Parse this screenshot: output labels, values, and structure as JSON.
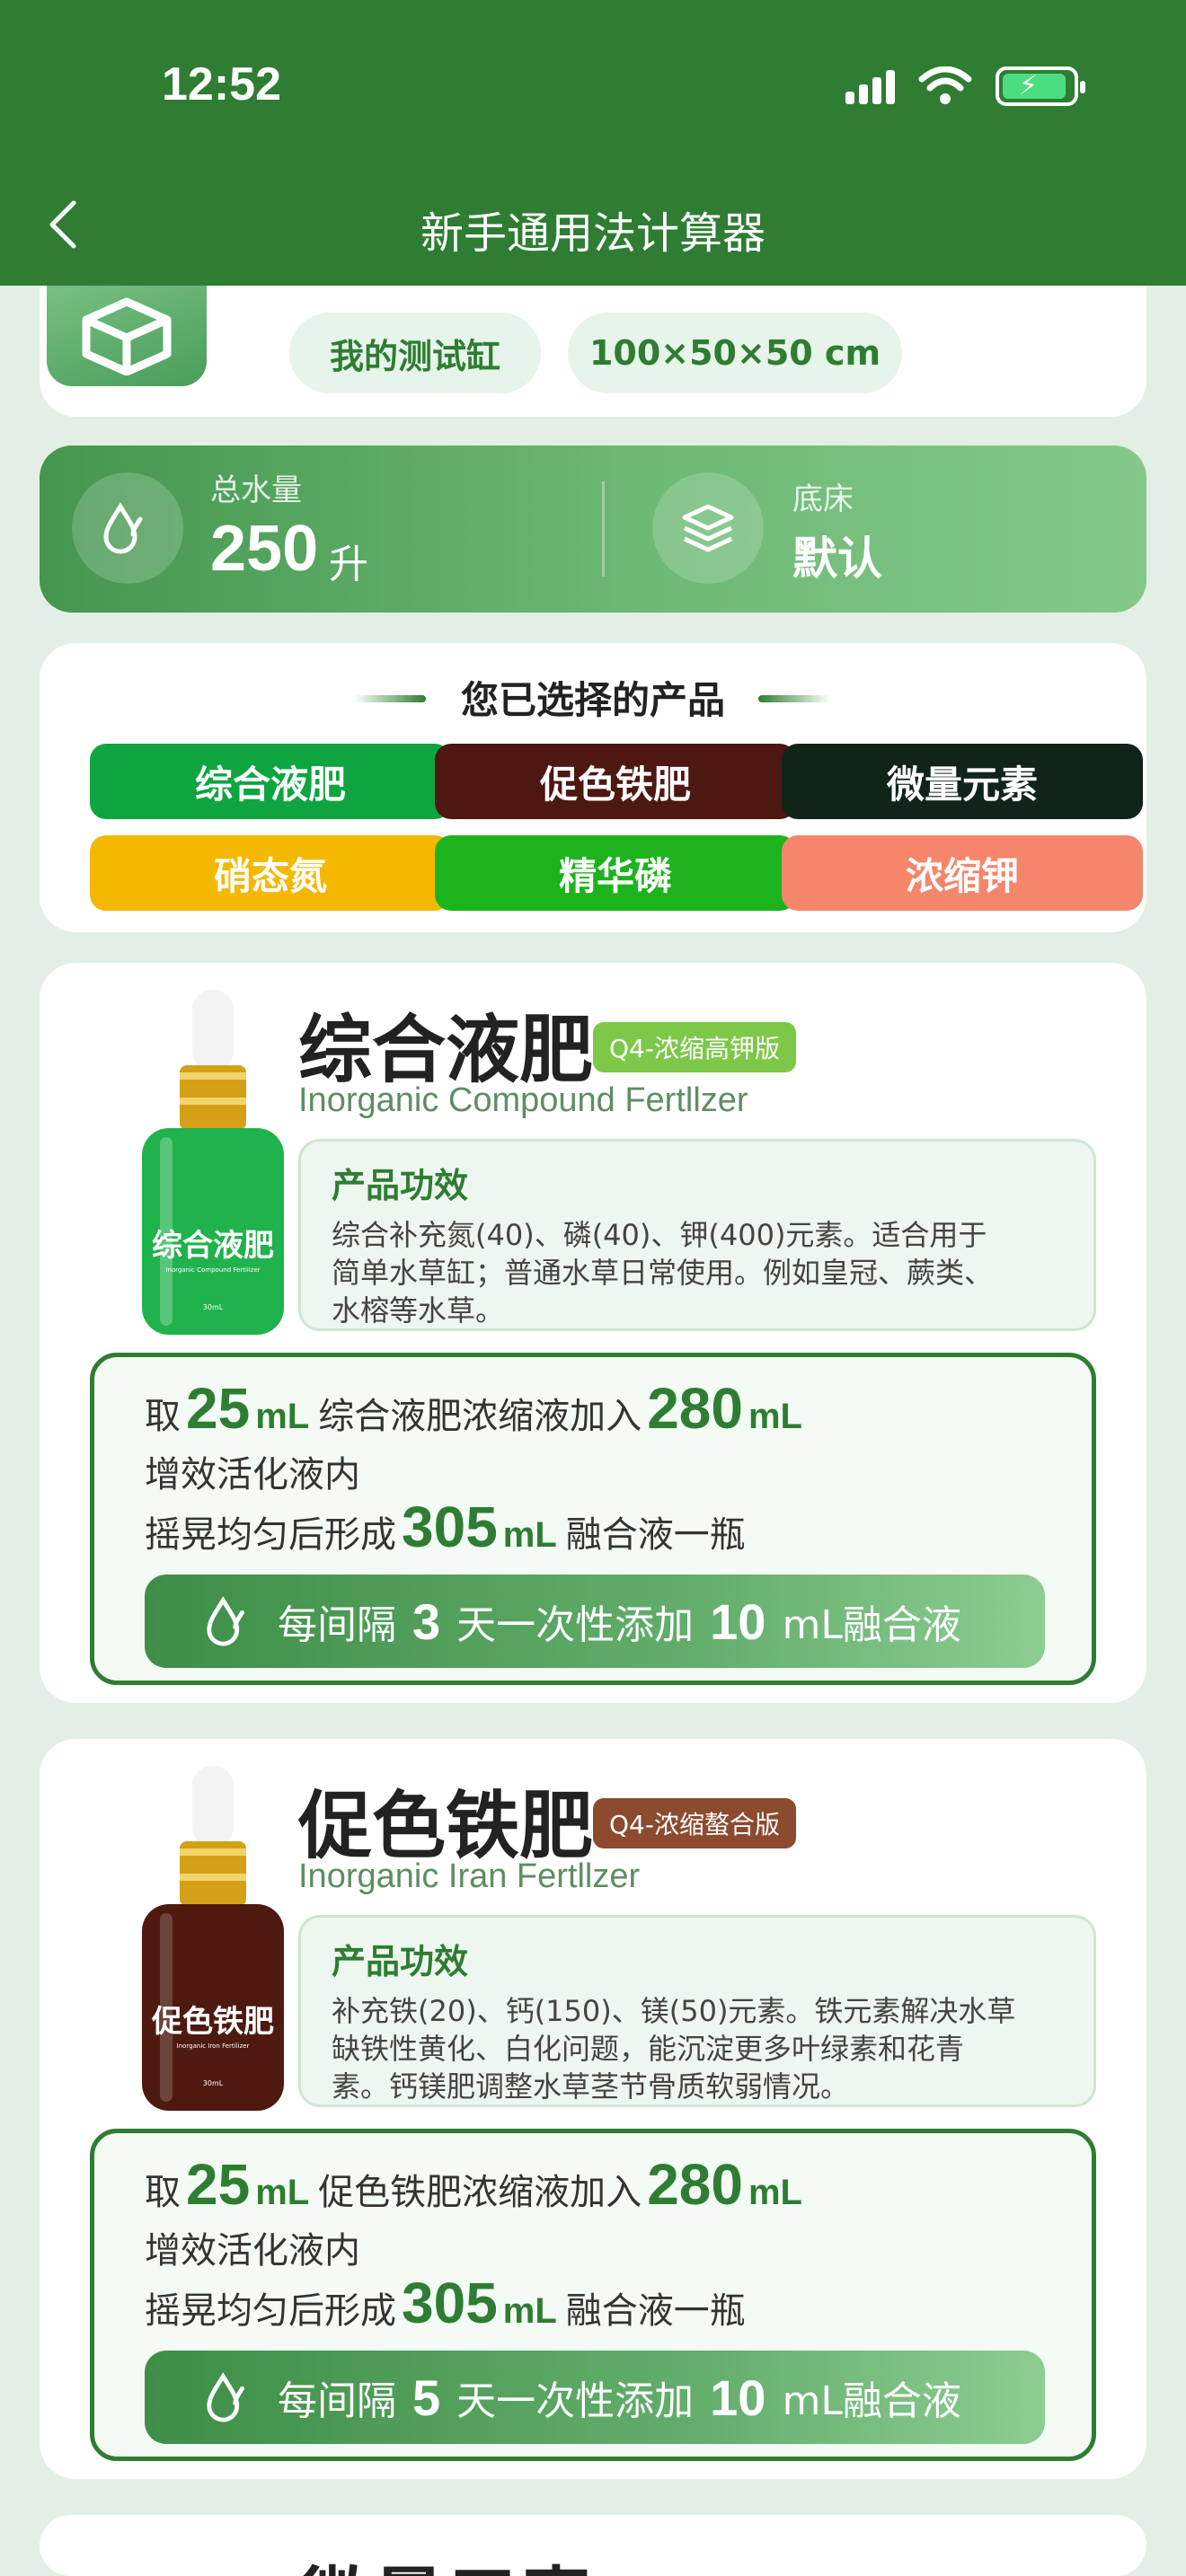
{
  "status_bar": {
    "time": "12:52"
  },
  "nav": {
    "title": "新手通用法计算器"
  },
  "tank": {
    "name": "我的测试缸",
    "size": "100×50×50 cm"
  },
  "water": {
    "label": "总水量",
    "value": "250",
    "unit": "升",
    "substrate_label": "底床",
    "substrate_value": "默认"
  },
  "selected": {
    "title": "您已选择的产品",
    "chips": [
      {
        "label": "综合液肥",
        "color": "#0ea540"
      },
      {
        "label": "促色铁肥",
        "color": "#4d1712"
      },
      {
        "label": "微量元素",
        "color": "#10241a"
      },
      {
        "label": "硝态氮",
        "color": "#f5b800"
      },
      {
        "label": "精华磷",
        "color": "#1db31d"
      },
      {
        "label": "浓缩钾",
        "color": "#f4866a"
      }
    ]
  },
  "products": [
    {
      "name": "综合液肥",
      "badge": "Q4-浓缩高钾版",
      "badge_color": "#7dc848",
      "subtitle": "Inorganic Compound Fertllzer",
      "bottle_color": "#20b24c",
      "bottle_label": "综合液肥",
      "bottle_sub": "Inorganic Compound Fertilizer",
      "bottle_volume": "30mL",
      "effect_title": "产品功效",
      "effect_lines": [
        "综合补充氮(40)、磷(40)、钾(400)元素。适合用于",
        "简单水草缸；普通水草日常使用。例如皇冠、蕨类、",
        "水榕等水草。"
      ],
      "recipe": {
        "take_prefix": "取",
        "take_amount": "25",
        "unit": "mL",
        "take_mid": "综合液肥浓缩液加入",
        "add_amount": "280",
        "line2": "增效活化液内",
        "mix_prefix": "摇晃均匀后形成",
        "mix_amount": "305",
        "mix_suffix": "融合液一瓶"
      },
      "dose": {
        "prefix": "每间隔",
        "days": "3",
        "mid": "天一次性添加",
        "amount": "10",
        "suffix": "mL融合液"
      }
    },
    {
      "name": "促色铁肥",
      "badge": "Q4-浓缩螯合版",
      "badge_color": "#8c4a2e",
      "subtitle": "Inorganic Iran Fertllzer",
      "bottle_color": "#4e1a10",
      "bottle_label": "促色铁肥",
      "bottle_sub": "Inorganic Iron Fertilizer",
      "bottle_volume": "30mL",
      "effect_title": "产品功效",
      "effect_lines": [
        "补充铁(20)、钙(150)、镁(50)元素。铁元素解决水草",
        "缺铁性黄化、白化问题，能沉淀更多叶绿素和花青",
        "素。钙镁肥调整水草茎节骨质软弱情况。"
      ],
      "recipe": {
        "take_prefix": "取",
        "take_amount": "25",
        "unit": "mL",
        "take_mid": "促色铁肥浓缩液加入",
        "add_amount": "280",
        "line2": "增效活化液内",
        "mix_prefix": "摇晃均匀后形成",
        "mix_amount": "305",
        "mix_suffix": "融合液一瓶"
      },
      "dose": {
        "prefix": "每间隔",
        "days": "5",
        "mid": "天一次性添加",
        "amount": "10",
        "suffix": "mL融合液"
      }
    },
    {
      "name": "微量元素"
    }
  ]
}
